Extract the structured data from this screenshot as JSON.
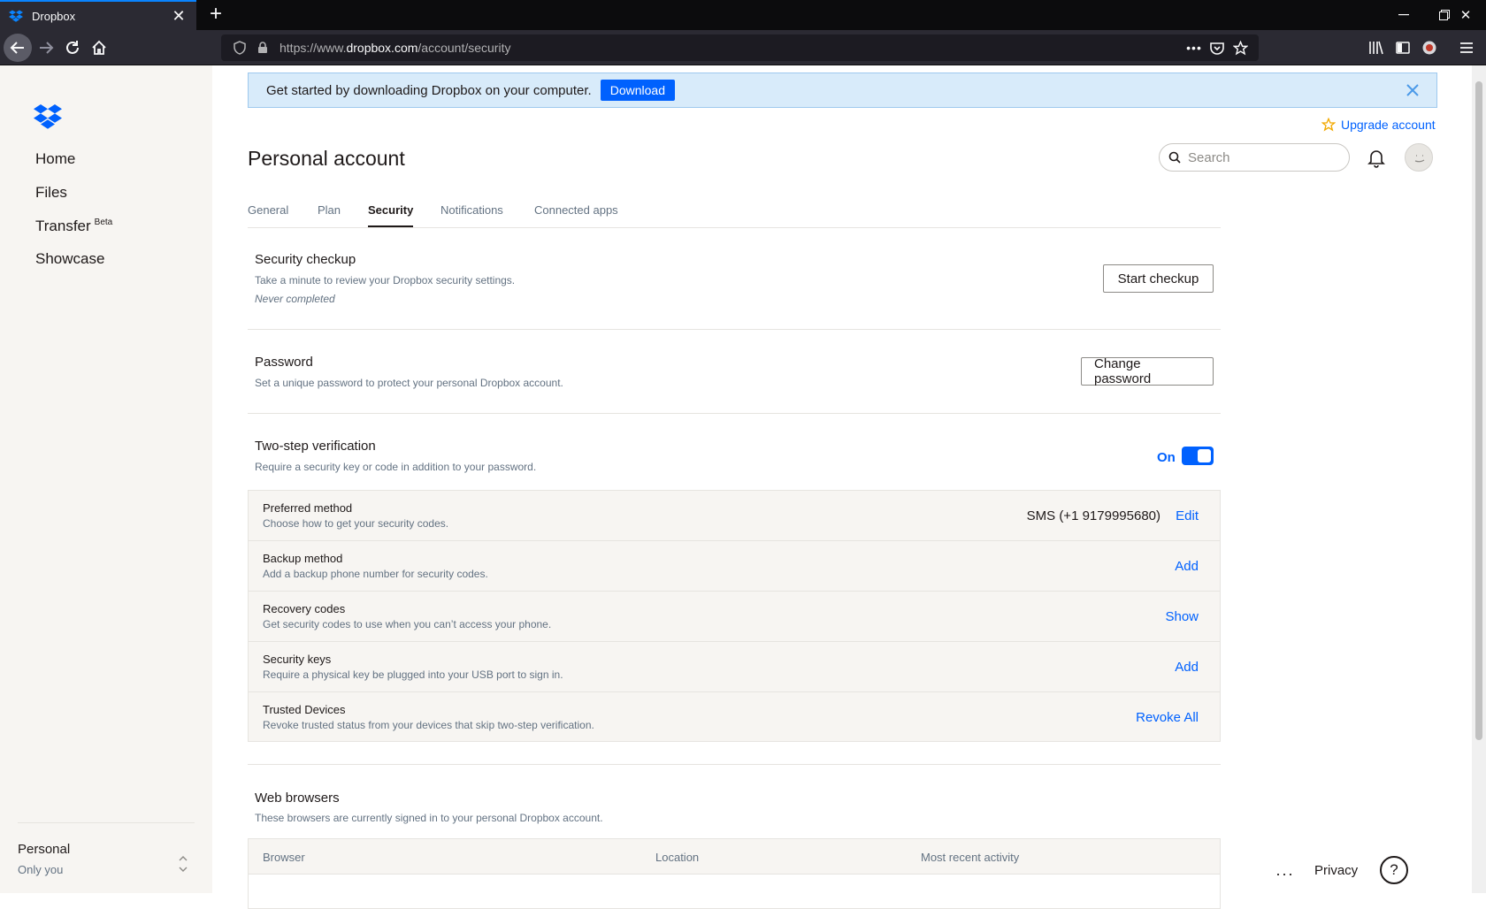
{
  "browser": {
    "tab_title": "Dropbox",
    "url_prefix": "https://www.",
    "url_domain": "dropbox.com",
    "url_path": "/account/security"
  },
  "sidebar": {
    "items": [
      {
        "label": "Home"
      },
      {
        "label": "Files"
      },
      {
        "label": "Transfer",
        "badge": "Beta"
      },
      {
        "label": "Showcase"
      }
    ],
    "account_name": "Personal",
    "account_sub": "Only you"
  },
  "banner": {
    "message": "Get started by downloading Dropbox on your computer.",
    "download_label": "Download"
  },
  "header": {
    "upgrade_label": "Upgrade account",
    "title": "Personal account",
    "search_placeholder": "Search"
  },
  "tabs": [
    {
      "label": "General"
    },
    {
      "label": "Plan"
    },
    {
      "label": "Security"
    },
    {
      "label": "Notifications"
    },
    {
      "label": "Connected apps"
    }
  ],
  "security_checkup": {
    "title": "Security checkup",
    "desc": "Take a minute to review your Dropbox security settings.",
    "note": "Never completed",
    "button": "Start checkup"
  },
  "password": {
    "title": "Password",
    "desc": "Set a unique password to protect your personal Dropbox account.",
    "button": "Change password"
  },
  "two_step": {
    "title": "Two-step verification",
    "desc": "Require a security key or code in addition to your password.",
    "toggle_label": "On",
    "enabled": true,
    "rows": [
      {
        "title": "Preferred method",
        "desc": "Choose how to get your security codes.",
        "value": "SMS (+1 9179995680)",
        "action": "Edit"
      },
      {
        "title": "Backup method",
        "desc": "Add a backup phone number for security codes.",
        "value": "",
        "action": "Add"
      },
      {
        "title": "Recovery codes",
        "desc": "Get security codes to use when you can’t access your phone.",
        "value": "",
        "action": "Show"
      },
      {
        "title": "Security keys",
        "desc": "Require a physical key be plugged into your USB port to sign in.",
        "value": "",
        "action": "Add"
      },
      {
        "title": "Trusted Devices",
        "desc": "Revoke trusted status from your devices that skip two-step verification.",
        "value": "",
        "action": "Revoke All"
      }
    ]
  },
  "web_browsers": {
    "title": "Web browsers",
    "desc": "These browsers are currently signed in to your personal Dropbox account.",
    "columns": [
      "Browser",
      "Location",
      "Most recent activity"
    ]
  },
  "footer": {
    "more": "···",
    "privacy": "Privacy",
    "help": "?"
  },
  "colors": {
    "accent": "#0061fe",
    "banner_bg": "#d8ebfa",
    "sidebar_bg": "#f7f5f2"
  }
}
